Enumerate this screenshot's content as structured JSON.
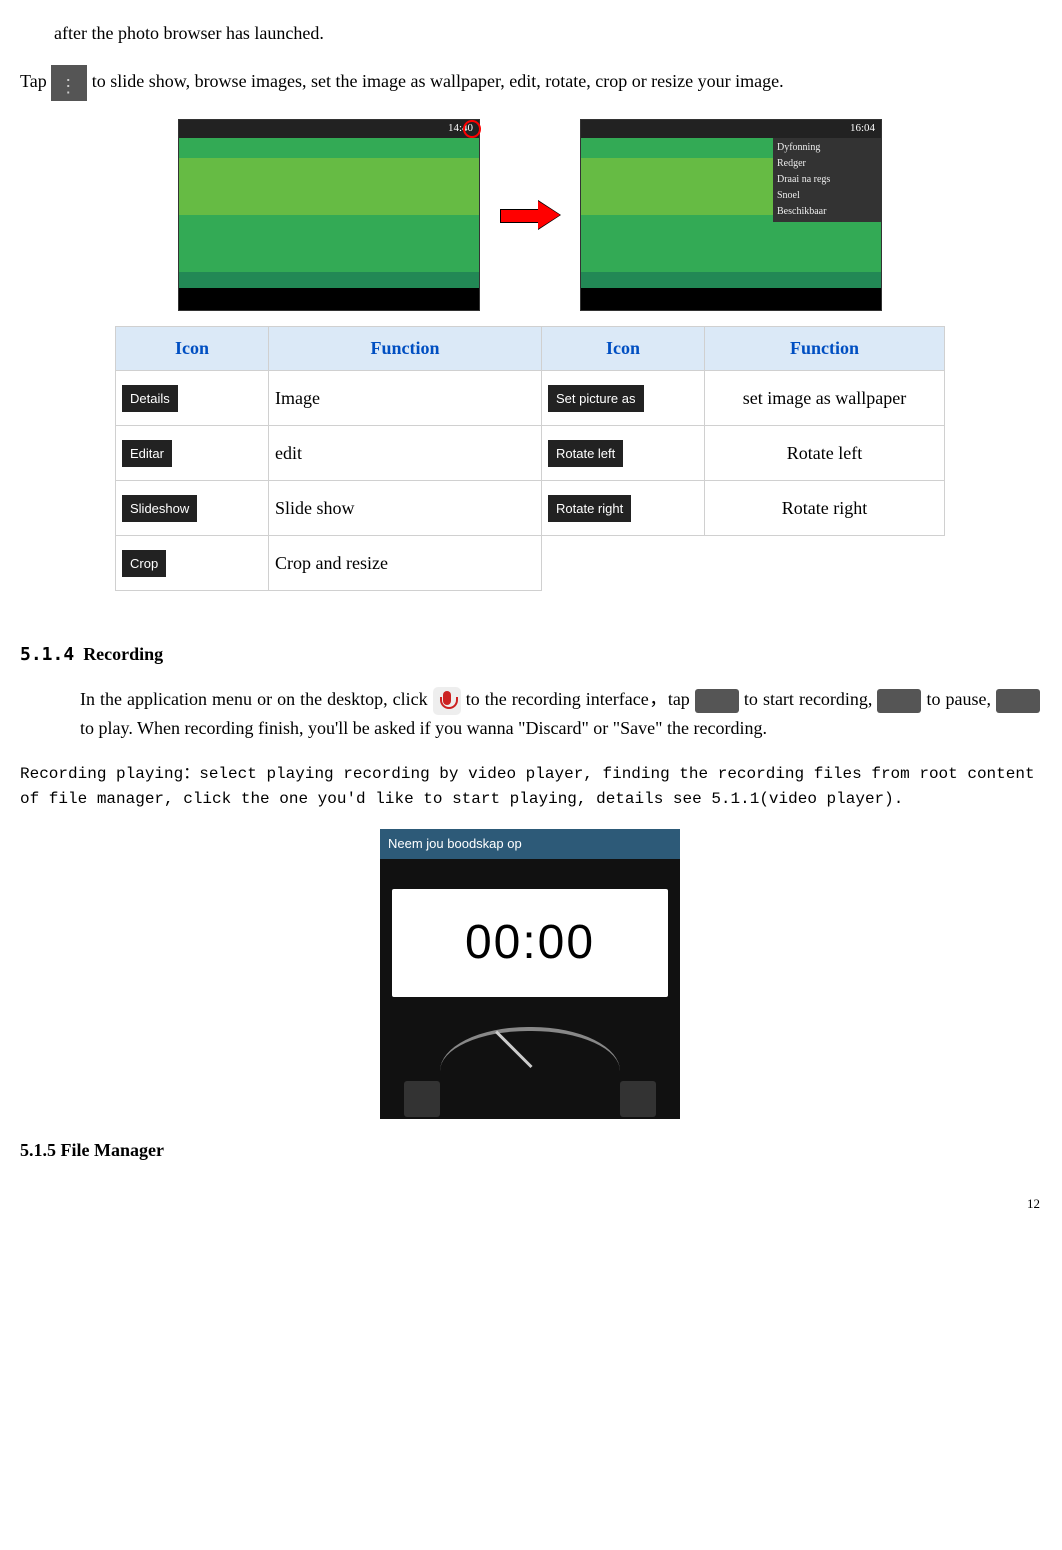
{
  "intro_line1": "after the photo browser has launched.",
  "intro_line2a": "Tap",
  "intro_line2b": "to slide show, browse images, set the image as wallpaper, edit, rotate, crop or resize your image.",
  "screenshot1_time": "14:40",
  "screenshot2_time": "16:04",
  "screenshot2_menu": [
    "Dyfonning",
    "Redger",
    "Draai na regs",
    "Snoel",
    "Beschikbaar"
  ],
  "table": {
    "headers": [
      "Icon",
      "Function",
      "Icon",
      "Function"
    ],
    "rows": [
      {
        "icon1": "Details",
        "func1": "Image",
        "icon2": "Set picture as",
        "func2": "set image as wallpaper"
      },
      {
        "icon1": "Editar",
        "func1": "edit",
        "icon2": "Rotate left",
        "func2": "Rotate left"
      },
      {
        "icon1": "Slideshow",
        "func1": "Slide show",
        "icon2": "Rotate right",
        "func2": "Rotate right"
      },
      {
        "icon1": "Crop",
        "func1": "Crop and resize",
        "icon2": "",
        "func2": ""
      }
    ]
  },
  "section_514_num": "5.1.4",
  "section_514_title": "Recording",
  "rec_p1a": "In the application menu or on the desktop, click ",
  "rec_p1b": "to the recording interface，tap",
  "rec_p1c": "to start recording, ",
  "rec_p1d": "to pause,",
  "rec_p1e": " to play. When recording finish, you'll be asked if you wanna \"Discard\" or \"Save\" the recording.",
  "rec_note": "Recording playing：select playing recording by video player, finding the recording files from root content of file manager, click the one you'd like to start playing, details see 5.1.1(video player).",
  "rec_app_header": "Neem jou boodskap op",
  "rec_app_time": "00:00",
  "section_515": "5.1.5 File Manager",
  "page_number": "12"
}
